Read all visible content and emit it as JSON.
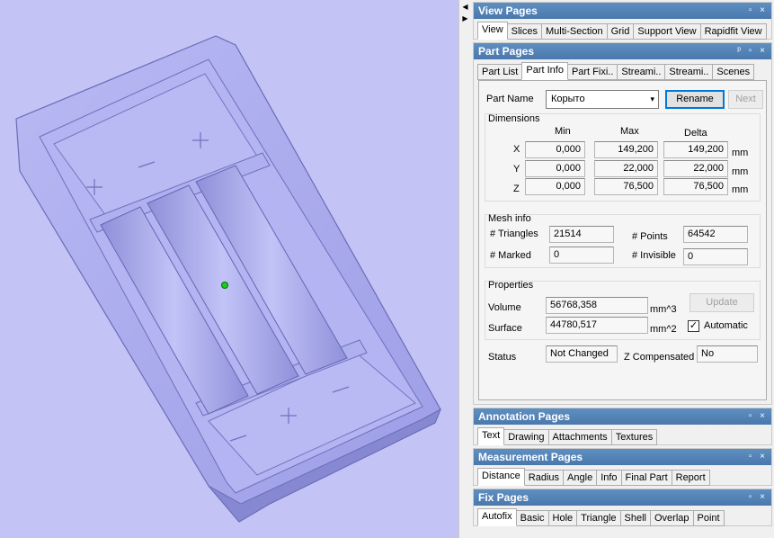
{
  "viewport": {
    "background": "#c3c3f5",
    "model_color": "#a9aaf0",
    "marker_color": "#18d018"
  },
  "view_pages": {
    "title": "View Pages",
    "tabs": [
      "View",
      "Slices",
      "Multi-Section",
      "Grid",
      "Support View",
      "Rapidfit View"
    ],
    "active_tab": "View"
  },
  "part_pages": {
    "title": "Part Pages",
    "tabs": [
      "Part List",
      "Part Info",
      "Part Fixi..",
      "Streami..",
      "Streami..",
      "Scenes"
    ],
    "active_tab": "Part Info",
    "part_name_label": "Part Name",
    "part_name_value": "Корыто",
    "rename_label": "Rename",
    "next_label": "Next",
    "dimensions": {
      "title": "Dimensions",
      "col_min": "Min",
      "col_max": "Max",
      "col_delta": "Delta",
      "x_label": "X",
      "y_label": "Y",
      "z_label": "Z",
      "x_min": "0,000",
      "x_max": "149,200",
      "x_delta": "149,200",
      "y_min": "0,000",
      "y_max": "22,000",
      "y_delta": "22,000",
      "z_min": "0,000",
      "z_max": "76,500",
      "z_delta": "76,500",
      "unit": "mm"
    },
    "mesh_info": {
      "title": "Mesh info",
      "triangles_label": "# Triangles",
      "triangles_value": "21514",
      "points_label": "# Points",
      "points_value": "64542",
      "marked_label": "# Marked",
      "marked_value": "0",
      "invisible_label": "# Invisible",
      "invisible_value": "0"
    },
    "properties": {
      "title": "Properties",
      "volume_label": "Volume",
      "volume_value": "56768,358",
      "volume_unit": "mm^3",
      "surface_label": "Surface",
      "surface_value": "44780,517",
      "surface_unit": "mm^2",
      "update_label": "Update",
      "automatic_label": "Automatic",
      "automatic_checked": true
    },
    "status_label": "Status",
    "status_value": "Not Changed",
    "z_compensated_label": "Z Compensated",
    "z_compensated_value": "No"
  },
  "annotation_pages": {
    "title": "Annotation Pages",
    "tabs": [
      "Text",
      "Drawing",
      "Attachments",
      "Textures"
    ],
    "active_tab": "Text"
  },
  "measurement_pages": {
    "title": "Measurement Pages",
    "tabs": [
      "Distance",
      "Radius",
      "Angle",
      "Info",
      "Final Part",
      "Report"
    ],
    "active_tab": "Distance"
  },
  "fix_pages": {
    "title": "Fix Pages",
    "tabs": [
      "Autofix",
      "Basic",
      "Hole",
      "Triangle",
      "Shell",
      "Overlap",
      "Point"
    ],
    "active_tab": "Autofix"
  },
  "header_buttons": {
    "pin": "ᵖ",
    "restore": "▫",
    "close": "×"
  }
}
